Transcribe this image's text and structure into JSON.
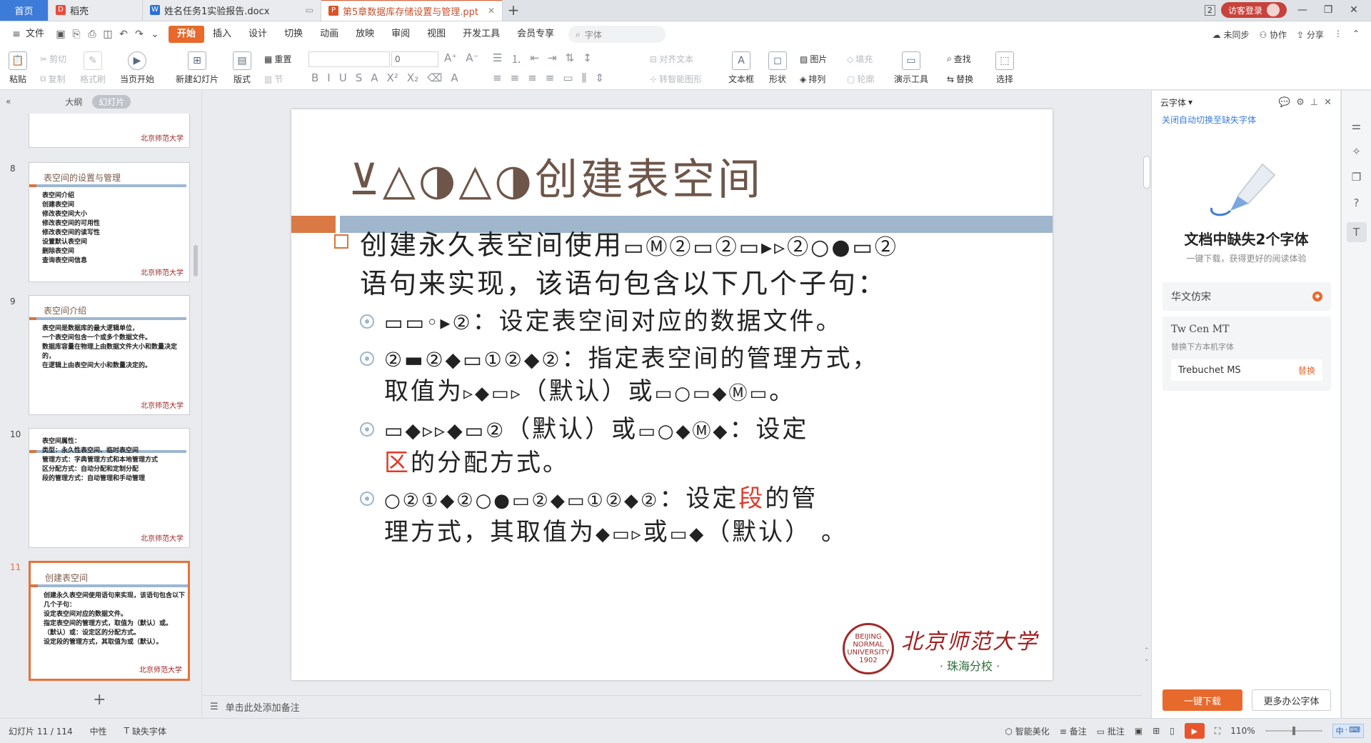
{
  "tabs": [
    {
      "label": "首页"
    },
    {
      "label": "稻壳"
    },
    {
      "label": "姓名任务1实验报告.docx"
    },
    {
      "label": "第5章数据库存储设置与管理.ppt"
    }
  ],
  "titlebar": {
    "badge": "2",
    "login": "访客登录"
  },
  "menu": {
    "file": "文件",
    "items": [
      "开始",
      "插入",
      "设计",
      "切换",
      "动画",
      "放映",
      "审阅",
      "视图",
      "开发工具",
      "会员专享"
    ],
    "search_placeholder": "字体",
    "right": [
      "未同步",
      "协作",
      "分享"
    ]
  },
  "ribbon": {
    "paste": "粘贴",
    "cut": "剪切",
    "copy": "复制",
    "format_painter": "格式刷",
    "from_current": "当页开始",
    "new_slide": "新建幻灯片",
    "layout": "版式",
    "reset": "重置",
    "section": "节",
    "font_size": "0",
    "align_text": "对齐文本",
    "to_smartart": "转智能图形",
    "textbox": "文本框",
    "shape": "形状",
    "picture": "图片",
    "arrange": "排列",
    "fill": "填充",
    "outline": "轮廓",
    "present_tool": "演示工具",
    "find": "查找",
    "replace": "替换",
    "select": "选择"
  },
  "left_panel": {
    "tab_outline": "大纲",
    "tab_slides": "幻灯片",
    "thumbs": [
      {
        "num": "",
        "title": "",
        "lines": []
      },
      {
        "num": "8",
        "title": "表空间的设置与管理",
        "lines": [
          "表空间介绍",
          "创建表空间",
          "修改表空间大小",
          "修改表空间的可用性",
          "修改表空间的读写性",
          "设置默认表空间",
          "删除表空间",
          "查询表空间信息"
        ]
      },
      {
        "num": "9",
        "title": "表空间介绍",
        "lines": [
          "表空间是数据库的最大逻辑单位，",
          "一个表空间包含一个或多个数据文件。",
          "数据库容量在物理上由数据文件大小和数量决定的，",
          "在逻辑上由表空间大小和数量决定的。"
        ]
      },
      {
        "num": "10",
        "title": "",
        "lines": [
          "表空间属性：",
          "类型：永久性表空间、临时表空间",
          "管理方式：字典管理方式和本地管理方式",
          "区分配方式：自动分配和定制分配",
          "段的管理方式：自动管理和手动管理"
        ]
      },
      {
        "num": "11",
        "title": "创建表空间",
        "lines": [
          "创建永久表空间使用语句来实现，该语句包含以下几个子句：",
          "设定表空间对应的数据文件。",
          "指定表空间的管理方式，取值为（默认）或。",
          "（默认）或：设定区的分配方式。",
          "设定段的管理方式，其取值为或（默认）。"
        ]
      }
    ],
    "logo_text": "北京师范大学"
  },
  "slide": {
    "title_glyphs": "⊻△◑△◑",
    "title": "创建表空间",
    "p1": "创建永久表空间使用",
    "p1_glyphs": "▭Ⓜ②▭②▭▸▹②○●▭②",
    "p1b": "语句来实现，该语句包含以下几个子句：",
    "s1_glyphs": "▭▭◦▸②",
    "s1": "：设定表空间对应的数据文件。",
    "s2_glyphs": "②▬②◆▭①②◆②",
    "s2": "：指定表空间的管理方式，",
    "s2b_pre": "取值为",
    "s2b_g1": "▹◆▭▹",
    "s2b_mid": "（默认）或",
    "s2b_g2": "▭○▭◆Ⓜ▭",
    "s2b_end": "。",
    "s3_glyphs": "▭◆▹▹◆▭②",
    "s3_mid": "（默认）或",
    "s3_g2": "▭○◆Ⓜ◆",
    "s3": "：设定",
    "s3_red": "区",
    "s3b": "的分配方式。",
    "s4_glyphs": "○②①◆②○●▭②◆▭①②◆②",
    "s4": "：设定",
    "s4_red": "段",
    "s4b": "的管",
    "s4c_pre": "理方式，其取值为",
    "s4c_g1": "◆▭▹",
    "s4c_mid": "或",
    "s4c_g2": "▭◆",
    "s4c_end": "（默认）  。",
    "logo_cn": "北京师范大学",
    "logo_sub": "· 珠海分校 ·",
    "seal": "BEIJING NORMAL UNIVERSITY 1902"
  },
  "notes_placeholder": "单击此处添加备注",
  "right_panel": {
    "header": "云字体",
    "link": "关闭自动切换至缺失字体",
    "heading": "文档中缺失2个字体",
    "subheading": "一键下载，获得更好的阅读体验",
    "font1": "华文仿宋",
    "font2": "Tw Cen MT",
    "font2_hint": "替换下方本机字体",
    "font2_replacement": "Trebuchet MS",
    "replace": "替换",
    "btn_download": "一键下载",
    "btn_more": "更多办公字体"
  },
  "status": {
    "slide_pos": "幻灯片 11 / 114",
    "theme": "中性",
    "missing_font": "缺失字体",
    "beautify": "智能美化",
    "notes": "备注",
    "comments": "批注",
    "zoom": "110%"
  },
  "colors": {
    "accent": "#e8692c",
    "brand_blue": "#3d7bd9",
    "slide_title": "#6d5649",
    "bar_blue": "#9fb6cc",
    "bar_orange": "#d97a45"
  }
}
